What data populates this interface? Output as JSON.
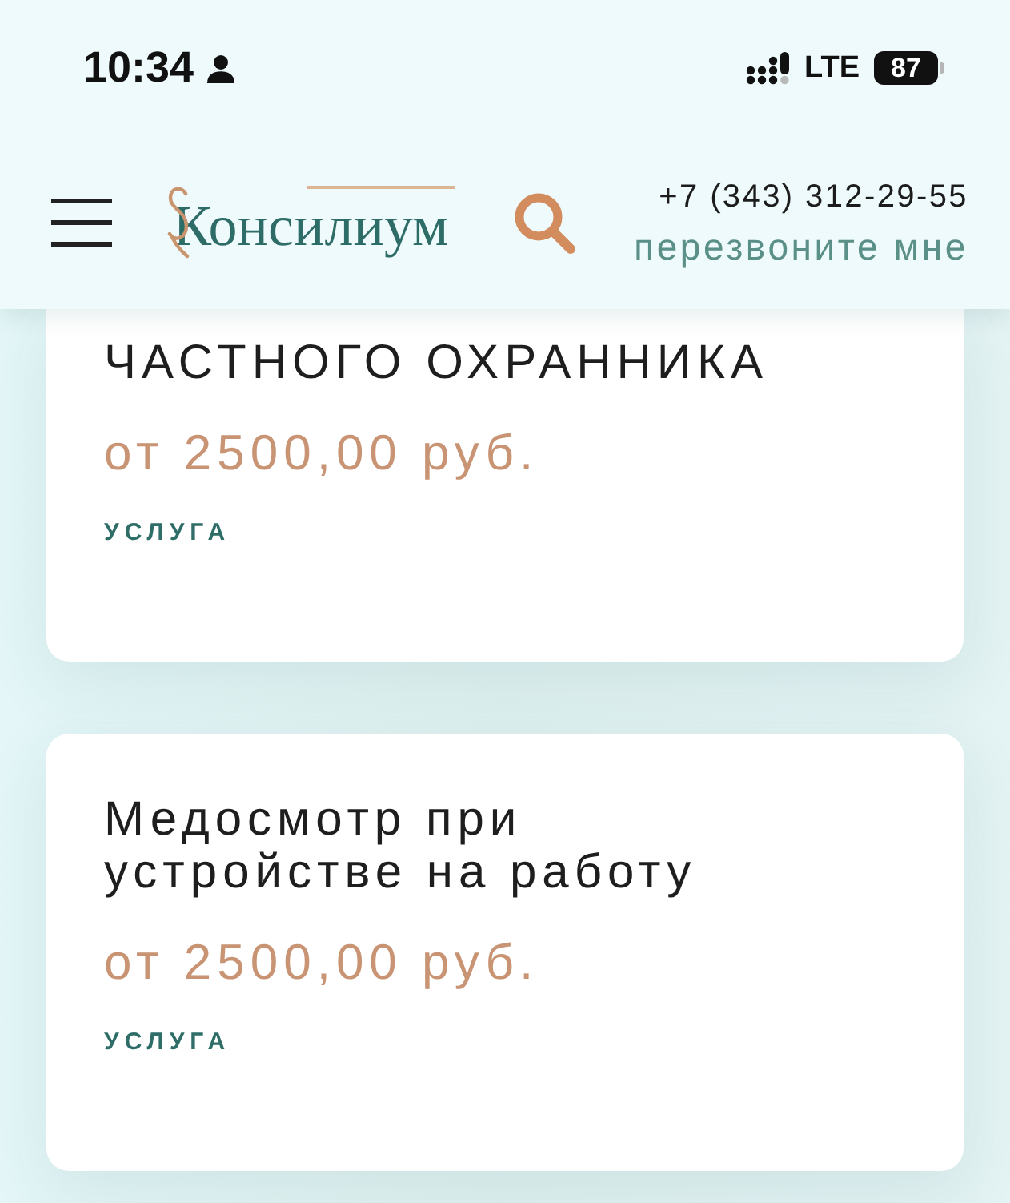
{
  "status_bar": {
    "time": "10:34",
    "network": "LTE",
    "battery": "87"
  },
  "header": {
    "logo": "Консилиум",
    "phone": "+7 (343) 312-29-55",
    "callback_link": "перезвоните мне"
  },
  "cards": [
    {
      "clipped_top": true,
      "title": "ЧАСТНОГО ОХРАННИКА",
      "price": "от 2500,00 руб.",
      "tag": "УСЛУГА"
    },
    {
      "clipped_top": false,
      "title": "Медосмотр при устройстве на работу",
      "price": "от 2500,00 руб.",
      "tag": "УСЛУГА"
    }
  ]
}
